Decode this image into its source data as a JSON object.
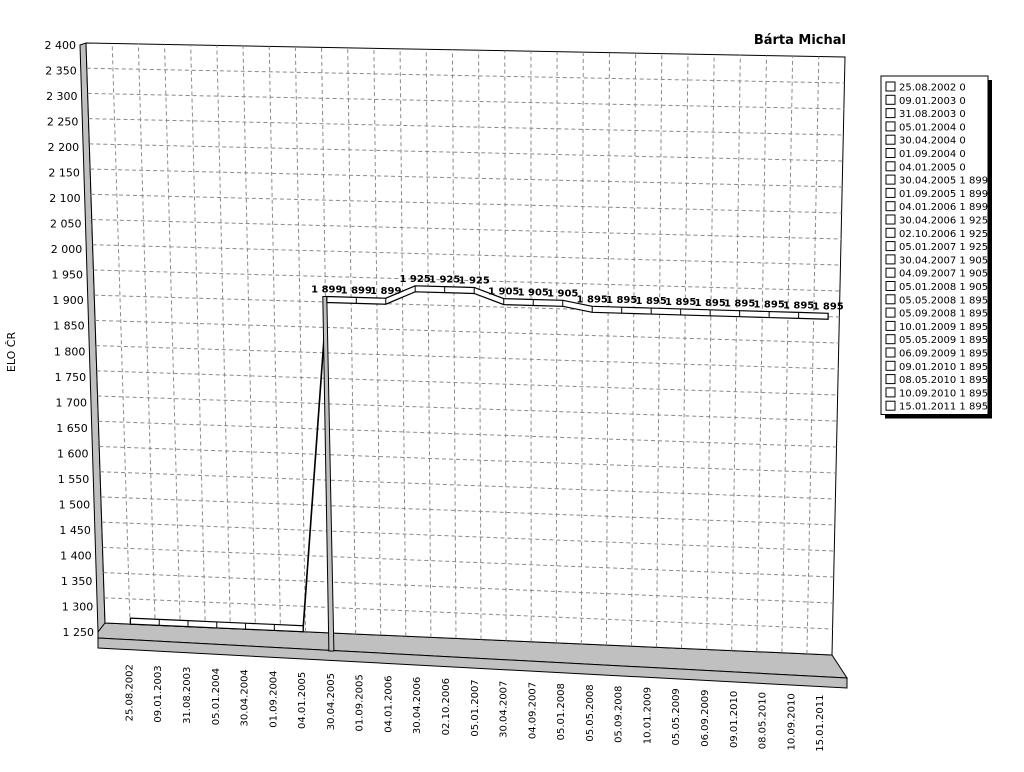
{
  "chart_data": {
    "type": "line",
    "title": "Bárta Michal",
    "xlabel": "",
    "ylabel": "ELO ČR",
    "ylim": [
      1250,
      2400
    ],
    "yticks": [
      2400,
      2350,
      2300,
      2250,
      2200,
      2150,
      2100,
      2050,
      2000,
      1950,
      1900,
      1850,
      1800,
      1750,
      1700,
      1650,
      1600,
      1550,
      1500,
      1450,
      1400,
      1350,
      1300,
      1250
    ],
    "ytick_labels": [
      "2 400",
      "2 350",
      "2 300",
      "2 250",
      "2 200",
      "2 150",
      "2 100",
      "2 050",
      "2 000",
      "1 950",
      "1 900",
      "1 850",
      "1 800",
      "1 750",
      "1 700",
      "1 650",
      "1 600",
      "1 550",
      "1 500",
      "1 450",
      "1 400",
      "1 350",
      "1 300",
      "1 250"
    ],
    "categories": [
      "25.08.2002",
      "09.01.2003",
      "31.08.2003",
      "05.01.2004",
      "30.04.2004",
      "01.09.2004",
      "04.01.2005",
      "30.04.2005",
      "01.09.2005",
      "04.01.2006",
      "30.04.2006",
      "02.10.2006",
      "05.01.2007",
      "30.04.2007",
      "04.09.2007",
      "05.01.2008",
      "05.05.2008",
      "05.09.2008",
      "10.01.2009",
      "05.05.2009",
      "06.09.2009",
      "09.01.2010",
      "08.05.2010",
      "10.09.2010",
      "15.01.2011"
    ],
    "values": [
      0,
      0,
      0,
      0,
      0,
      0,
      0,
      1899,
      1899,
      1899,
      1925,
      1925,
      1925,
      1905,
      1905,
      1905,
      1895,
      1895,
      1895,
      1895,
      1895,
      1895,
      1895,
      1895,
      1895
    ],
    "value_labels": [
      "",
      "",
      "",
      "",
      "",
      "",
      "",
      "1 899",
      "1 899",
      "1 899",
      "1 925",
      "1 925",
      "1 925",
      "1 905",
      "1 905",
      "1 905",
      "1 895",
      "1 895",
      "1 895",
      "1 895",
      "1 895",
      "1 895",
      "1 895",
      "1 895",
      "1 895"
    ],
    "legend": [
      "25.08.2002 0",
      "09.01.2003 0",
      "31.08.2003 0",
      "05.01.2004 0",
      "30.04.2004 0",
      "01.09.2004 0",
      "04.01.2005 0",
      "30.04.2005 1 899",
      "01.09.2005 1 899",
      "04.01.2006 1 899",
      "30.04.2006 1 925",
      "02.10.2006 1 925",
      "05.01.2007 1 925",
      "30.04.2007 1 905",
      "04.09.2007 1 905",
      "05.01.2008 1 905",
      "05.05.2008 1 895",
      "05.09.2008 1 895",
      "10.01.2009 1 895",
      "05.05.2009 1 895",
      "06.09.2009 1 895",
      "09.01.2010 1 895",
      "08.05.2010 1 895",
      "10.09.2010 1 895",
      "15.01.2011 1 895"
    ],
    "legend_position": "right",
    "grid": true,
    "style": "3d",
    "colors": {
      "line_fill": "#ffffff",
      "wall": "#c0c0c0",
      "grid": "#8a8a8a",
      "edge": "#000000"
    }
  }
}
